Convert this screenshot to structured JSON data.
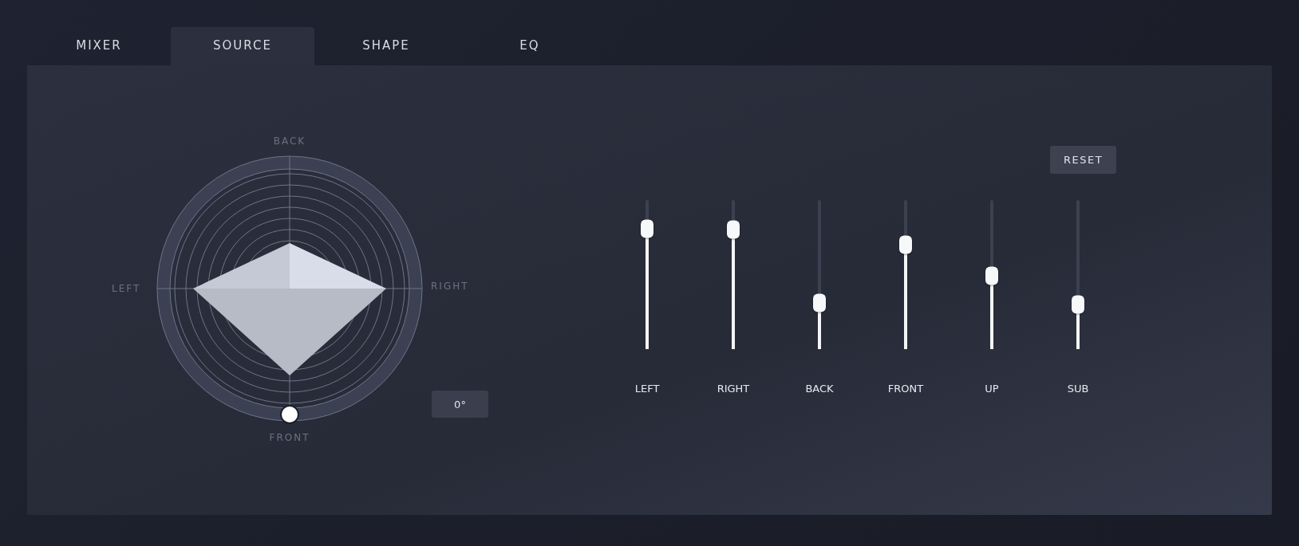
{
  "tabs": [
    {
      "label": "MIXER",
      "selected": false
    },
    {
      "label": "SOURCE",
      "selected": true
    },
    {
      "label": "SHAPE",
      "selected": false
    },
    {
      "label": "EQ",
      "selected": false
    }
  ],
  "panner": {
    "back_label": "BACK",
    "left_label": "LEFT",
    "right_label": "RIGHT",
    "front_label": "FRONT",
    "angle": "0°"
  },
  "reset_button": "RESET",
  "sliders": [
    {
      "label": "LEFT",
      "level": 0.81
    },
    {
      "label": "RIGHT",
      "level": 0.8
    },
    {
      "label": "BACK",
      "level": 0.31
    },
    {
      "label": "FRONT",
      "level": 0.7
    },
    {
      "label": "UP",
      "level": 0.49
    },
    {
      "label": "SUB",
      "level": 0.3
    }
  ]
}
